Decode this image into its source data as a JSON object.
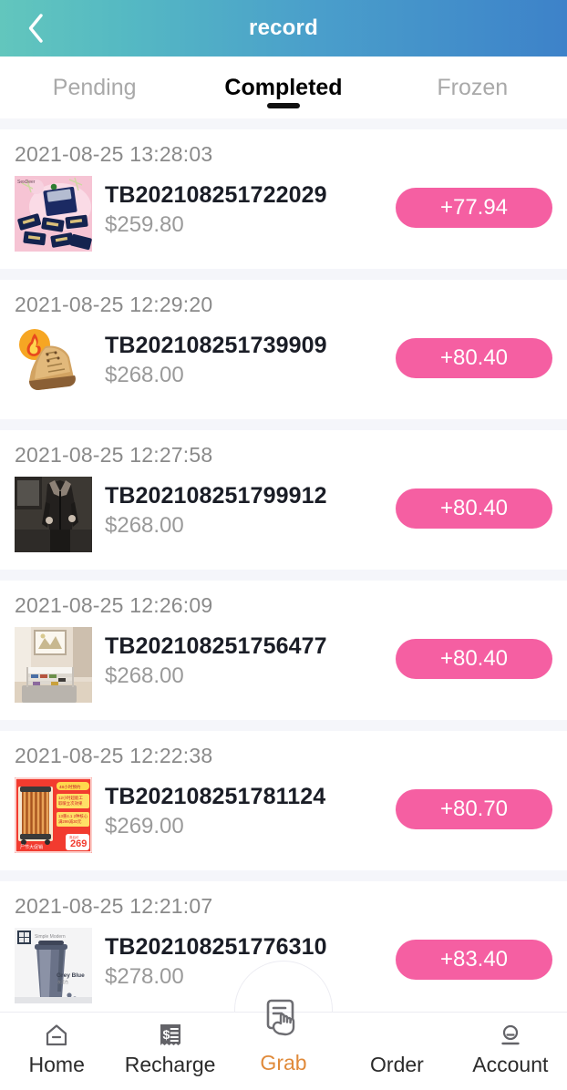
{
  "header": {
    "title": "record",
    "back_icon": "chevron-left-icon",
    "gradient_from": "#62c6bd",
    "gradient_to": "#3d82c9"
  },
  "tabs": [
    {
      "label": "Pending",
      "active": false
    },
    {
      "label": "Completed",
      "active": true
    },
    {
      "label": "Frozen",
      "active": false
    }
  ],
  "accent": {
    "commission_bg": "#f55fa2",
    "commission_text": "#ffffff",
    "separator": "#f5f6fa"
  },
  "records": [
    {
      "date": "2021-08-25 13:28:03",
      "order_no": "TB202108251722029",
      "price": "$259.80",
      "commission": "+77.94",
      "thumb": "navy-product-packets-on-pink"
    },
    {
      "date": "2021-08-25 12:29:20",
      "order_no": "TB202108251739909",
      "price": "$268.00",
      "commission": "+80.40",
      "thumb": "tan-work-boot-with-flame"
    },
    {
      "date": "2021-08-25 12:27:58",
      "order_no": "TB202108251799912",
      "price": "$268.00",
      "commission": "+80.40",
      "thumb": "man-in-dark-leather-jacket"
    },
    {
      "date": "2021-08-25 12:26:09",
      "order_no": "TB202108251756477",
      "price": "$268.00",
      "commission": "+80.40",
      "thumb": "white-shoe-rack-in-hallway"
    },
    {
      "date": "2021-08-25 12:22:38",
      "order_no": "TB202108251781124",
      "price": "$269.00",
      "commission": "+80.70",
      "thumb": "oil-heater-red-promo-banner"
    },
    {
      "date": "2021-08-25 12:21:07",
      "order_no": "TB202108251776310",
      "price": "$278.00",
      "commission": "+83.40",
      "thumb": "grey-blue-travel-tumbler"
    }
  ],
  "bottom_nav": [
    {
      "label": "Home",
      "icon": "house-icon"
    },
    {
      "label": "Recharge",
      "icon": "receipt-dollar-icon"
    },
    {
      "label": "Grab",
      "icon": "hand-tap-document-icon"
    },
    {
      "label": "Order",
      "icon": "none"
    },
    {
      "label": "Account",
      "icon": "person-icon"
    }
  ]
}
